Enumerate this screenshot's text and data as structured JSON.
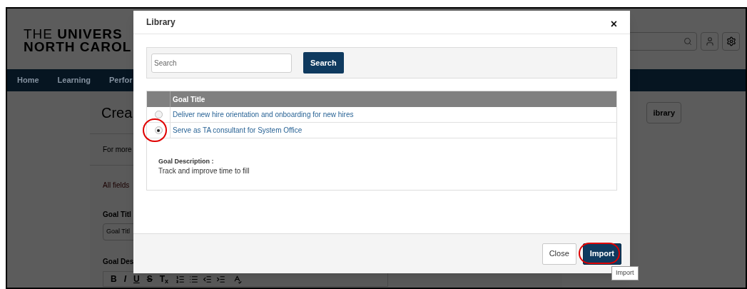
{
  "background_page": {
    "logo": {
      "line1": "THE **UNIVERS**",
      "line2": "NORTH CAROL"
    },
    "nav": [
      "Home",
      "Learning",
      "Perfor"
    ],
    "heading": "Crea",
    "info": "For more",
    "required_note": "All fields",
    "goal_title_label": "Goal Titl",
    "goal_title_placeholder": "Goal Titl",
    "goal_description_label": "Goal Des",
    "library_button": "ibrary",
    "toolbar": [
      "B",
      "I",
      "U",
      "S",
      "T$_{x}$"
    ]
  },
  "dialog": {
    "title": "Library",
    "close": "×",
    "search": {
      "placeholder": "Search",
      "button": "Search"
    },
    "table": {
      "columns": [
        "Goal Title"
      ],
      "rows": [
        {
          "title": "Deliver new hire orientation and onboarding for new hires",
          "selected": false
        },
        {
          "title": "Serve as TA consultant for System Office",
          "selected": true
        }
      ]
    },
    "description_label": "Goal Description :",
    "description": "Track and improve time to fill",
    "buttons": [
      {
        "label": "Close",
        "kind": "secondary"
      },
      {
        "label": "Import",
        "kind": "primary"
      }
    ],
    "tooltip": "Import"
  }
}
